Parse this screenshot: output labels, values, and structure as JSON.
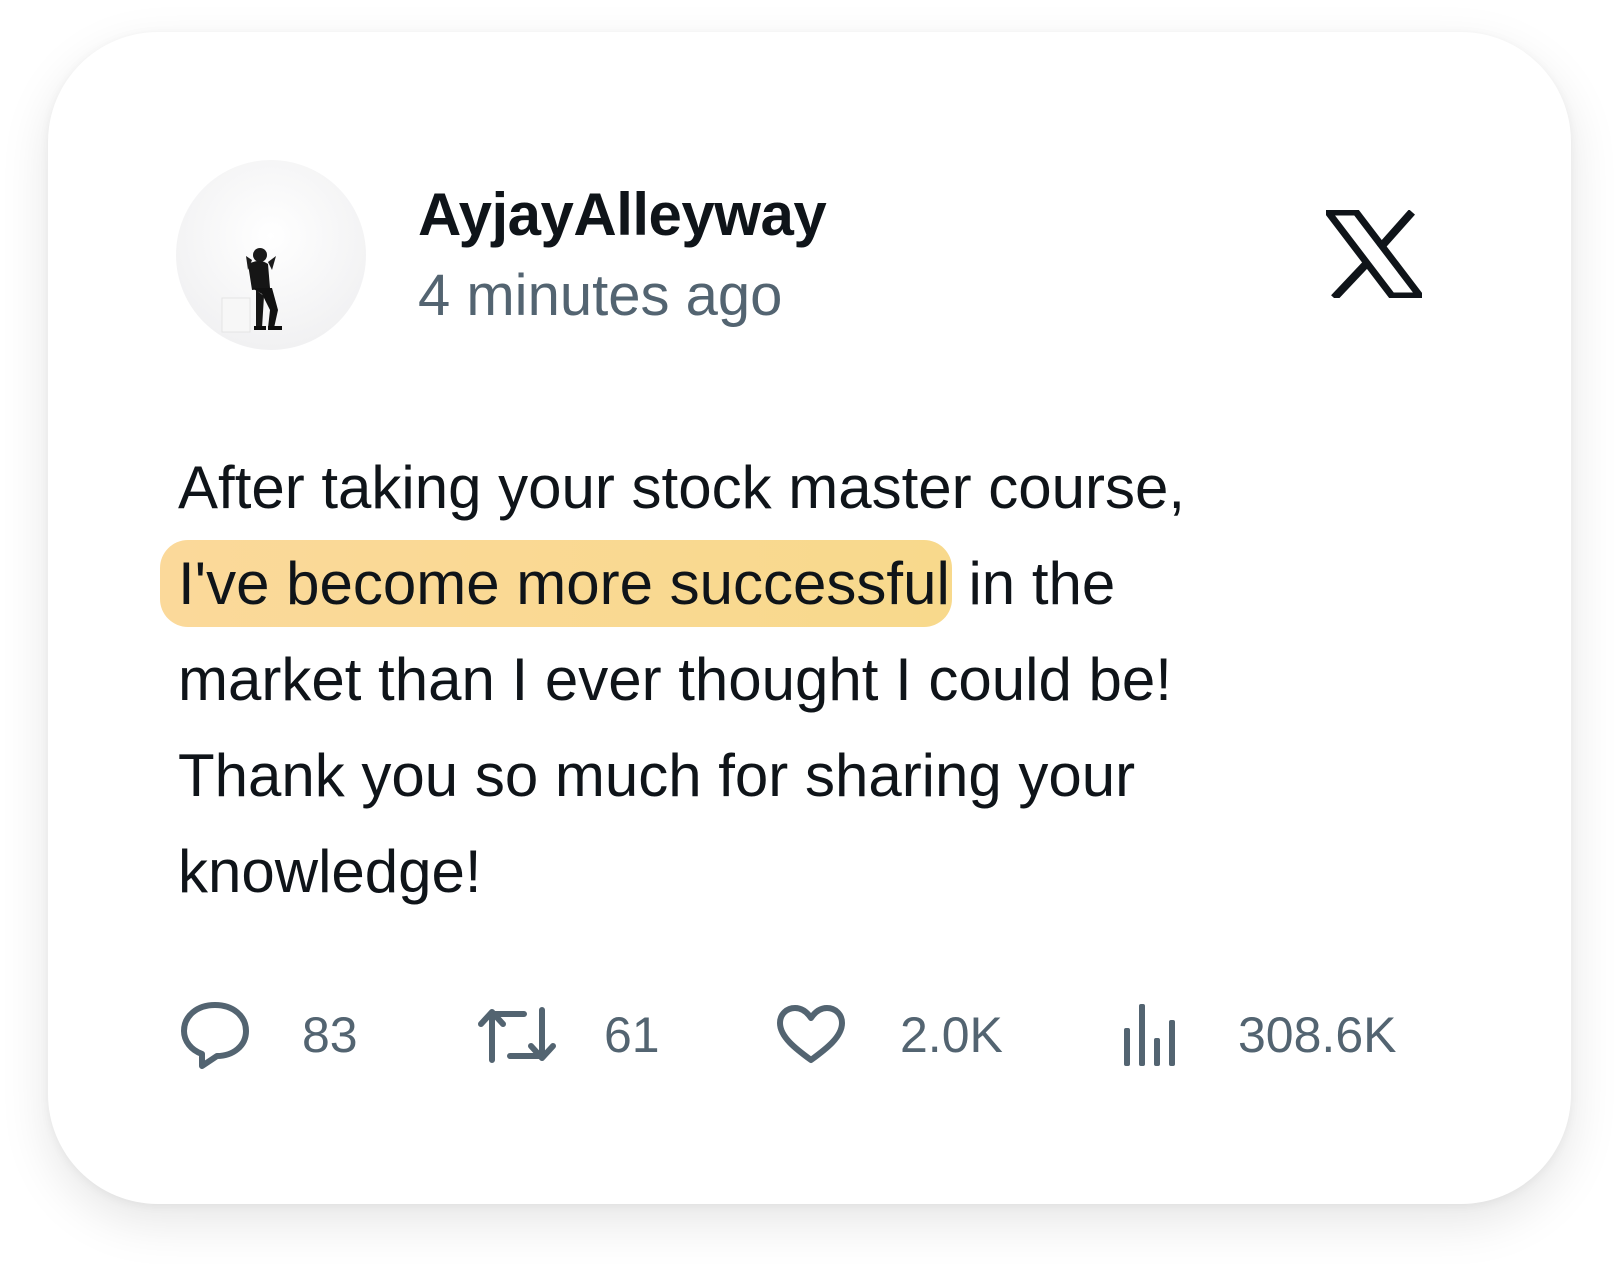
{
  "post": {
    "author": {
      "username": "AyjayAlleyway",
      "avatar_icon": "avatar-photo-seated-person"
    },
    "timestamp": "4 minutes ago",
    "platform_icon": "x-logo-icon",
    "text": {
      "line1": "After taking your stock master course,",
      "line2_highlight": "I've become more successful",
      "line2_rest": " in the",
      "line3": "market than I ever thought I could be!",
      "line4": "Thank you so much for sharing your",
      "line5": "knowledge!"
    },
    "highlight_color": "#f9d98f",
    "actions": [
      {
        "icon": "reply-icon",
        "count": "83"
      },
      {
        "icon": "retweet-icon",
        "count": "61"
      },
      {
        "icon": "heart-icon",
        "count": "2.0K"
      },
      {
        "icon": "views-icon",
        "count": "308.6K"
      }
    ]
  },
  "colors": {
    "text_primary": "#0f1419",
    "text_secondary": "#536471",
    "icon": "#536471"
  }
}
